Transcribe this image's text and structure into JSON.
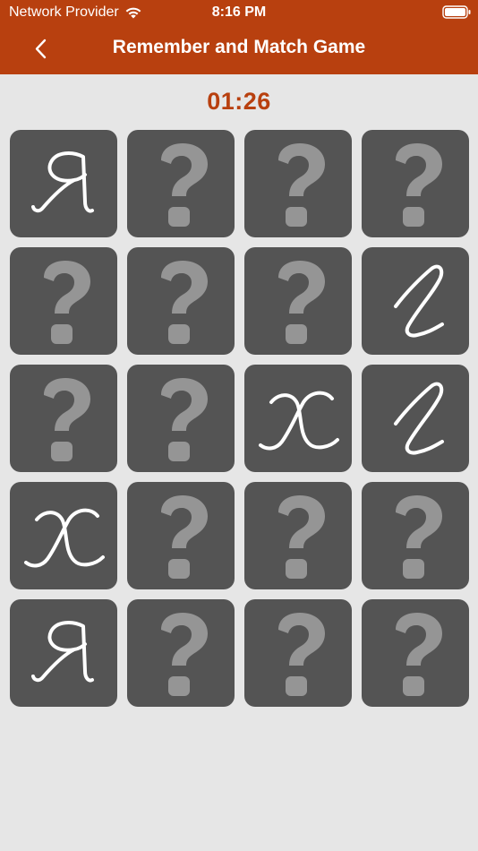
{
  "status_bar": {
    "carrier": "Network Provider",
    "time": "8:16 PM"
  },
  "nav": {
    "title": "Remember and Match Game",
    "back_icon": "chevron-left-icon"
  },
  "timer": "01:26",
  "colors": {
    "header": "#b8400f",
    "timer": "#b8400f",
    "card": "#545454",
    "question_mark": "#959595",
    "letter": "#ffffff",
    "background": "#e6e6e6"
  },
  "grid": {
    "columns": 4,
    "cards": [
      {
        "state": "revealed",
        "glyph": "ya"
      },
      {
        "state": "hidden",
        "glyph": "question"
      },
      {
        "state": "hidden",
        "glyph": "question"
      },
      {
        "state": "hidden",
        "glyph": "question"
      },
      {
        "state": "hidden",
        "glyph": "question"
      },
      {
        "state": "hidden",
        "glyph": "question"
      },
      {
        "state": "hidden",
        "glyph": "question"
      },
      {
        "state": "revealed",
        "glyph": "l"
      },
      {
        "state": "hidden",
        "glyph": "question"
      },
      {
        "state": "hidden",
        "glyph": "question"
      },
      {
        "state": "revealed",
        "glyph": "x"
      },
      {
        "state": "revealed",
        "glyph": "l"
      },
      {
        "state": "revealed",
        "glyph": "x"
      },
      {
        "state": "hidden",
        "glyph": "question"
      },
      {
        "state": "hidden",
        "glyph": "question"
      },
      {
        "state": "hidden",
        "glyph": "question"
      },
      {
        "state": "revealed",
        "glyph": "ya"
      },
      {
        "state": "hidden",
        "glyph": "question"
      },
      {
        "state": "hidden",
        "glyph": "question"
      },
      {
        "state": "hidden",
        "glyph": "question"
      }
    ]
  }
}
